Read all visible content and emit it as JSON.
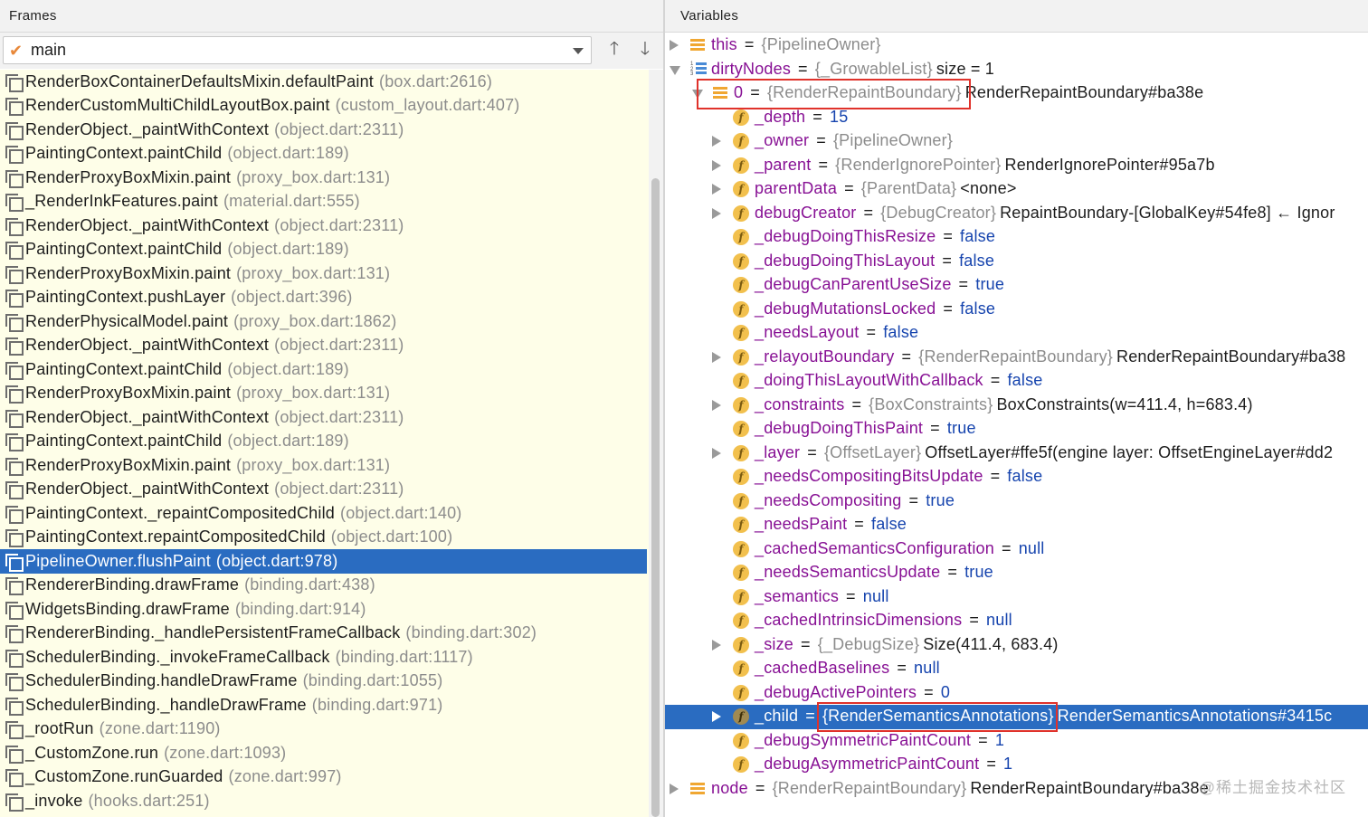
{
  "frames_panel": {
    "title": "Frames",
    "thread": {
      "check": "✔",
      "name": "main"
    },
    "up_arrow": "🡑",
    "down_arrow": "🡓",
    "frames": [
      {
        "name": "RenderBoxContainerDefaultsMixin.defaultPaint",
        "loc": "(box.dart:2616)"
      },
      {
        "name": "RenderCustomMultiChildLayoutBox.paint",
        "loc": "(custom_layout.dart:407)"
      },
      {
        "name": "RenderObject._paintWithContext",
        "loc": "(object.dart:2311)"
      },
      {
        "name": "PaintingContext.paintChild",
        "loc": "(object.dart:189)"
      },
      {
        "name": "RenderProxyBoxMixin.paint",
        "loc": "(proxy_box.dart:131)"
      },
      {
        "name": "_RenderInkFeatures.paint",
        "loc": "(material.dart:555)"
      },
      {
        "name": "RenderObject._paintWithContext",
        "loc": "(object.dart:2311)"
      },
      {
        "name": "PaintingContext.paintChild",
        "loc": "(object.dart:189)"
      },
      {
        "name": "RenderProxyBoxMixin.paint",
        "loc": "(proxy_box.dart:131)"
      },
      {
        "name": "PaintingContext.pushLayer",
        "loc": "(object.dart:396)"
      },
      {
        "name": "RenderPhysicalModel.paint",
        "loc": "(proxy_box.dart:1862)"
      },
      {
        "name": "RenderObject._paintWithContext",
        "loc": "(object.dart:2311)"
      },
      {
        "name": "PaintingContext.paintChild",
        "loc": "(object.dart:189)"
      },
      {
        "name": "RenderProxyBoxMixin.paint",
        "loc": "(proxy_box.dart:131)"
      },
      {
        "name": "RenderObject._paintWithContext",
        "loc": "(object.dart:2311)"
      },
      {
        "name": "PaintingContext.paintChild",
        "loc": "(object.dart:189)"
      },
      {
        "name": "RenderProxyBoxMixin.paint",
        "loc": "(proxy_box.dart:131)"
      },
      {
        "name": "RenderObject._paintWithContext",
        "loc": "(object.dart:2311)"
      },
      {
        "name": "PaintingContext._repaintCompositedChild",
        "loc": "(object.dart:140)"
      },
      {
        "name": "PaintingContext.repaintCompositedChild",
        "loc": "(object.dart:100)"
      },
      {
        "name": "PipelineOwner.flushPaint",
        "loc": "(object.dart:978)",
        "selected": true
      },
      {
        "name": "RendererBinding.drawFrame",
        "loc": "(binding.dart:438)"
      },
      {
        "name": "WidgetsBinding.drawFrame",
        "loc": "(binding.dart:914)"
      },
      {
        "name": "RendererBinding._handlePersistentFrameCallback",
        "loc": "(binding.dart:302)"
      },
      {
        "name": "SchedulerBinding._invokeFrameCallback",
        "loc": "(binding.dart:1117)"
      },
      {
        "name": "SchedulerBinding.handleDrawFrame",
        "loc": "(binding.dart:1055)"
      },
      {
        "name": "SchedulerBinding._handleDrawFrame",
        "loc": "(binding.dart:971)"
      },
      {
        "name": "_rootRun",
        "loc": "(zone.dart:1190)"
      },
      {
        "name": "_CustomZone.run",
        "loc": "(zone.dart:1093)"
      },
      {
        "name": "_CustomZone.runGuarded",
        "loc": "(zone.dart:997)"
      },
      {
        "name": "_invoke",
        "loc": "(hooks.dart:251)"
      }
    ]
  },
  "variables_panel": {
    "title": "Variables",
    "vars": [
      {
        "level": 0,
        "toggle": "closed",
        "icon": "object",
        "name": "this",
        "type": "{PipelineOwner}",
        "value": ""
      },
      {
        "level": 0,
        "toggle": "open",
        "icon": "list",
        "name": "dirtyNodes",
        "type": "{_GrowableList}",
        "value": "size = 1"
      },
      {
        "level": 1,
        "toggle": "open",
        "icon": "object",
        "name": "0",
        "type": "{RenderRepaintBoundary}",
        "value": "RenderRepaintBoundary#ba38e",
        "highlight": true
      },
      {
        "level": 2,
        "toggle": "none",
        "icon": "field",
        "name": "_depth",
        "type": "",
        "value": "15",
        "value_style": "literal"
      },
      {
        "level": 2,
        "toggle": "closed",
        "icon": "field",
        "name": "_owner",
        "type": "{PipelineOwner}",
        "value": ""
      },
      {
        "level": 2,
        "toggle": "closed",
        "icon": "field",
        "name": "_parent",
        "type": "{RenderIgnorePointer}",
        "value": "RenderIgnorePointer#95a7b"
      },
      {
        "level": 2,
        "toggle": "closed",
        "icon": "field",
        "name": "parentData",
        "type": "{ParentData}",
        "value": "<none>"
      },
      {
        "level": 2,
        "toggle": "closed",
        "icon": "field",
        "name": "debugCreator",
        "type": "{DebugCreator}",
        "value": "RepaintBoundary-[GlobalKey#54fe8] ← Ignor"
      },
      {
        "level": 2,
        "toggle": "none",
        "icon": "field",
        "name": "_debugDoingThisResize",
        "type": "",
        "value": "false",
        "value_style": "literal"
      },
      {
        "level": 2,
        "toggle": "none",
        "icon": "field",
        "name": "_debugDoingThisLayout",
        "type": "",
        "value": "false",
        "value_style": "literal"
      },
      {
        "level": 2,
        "toggle": "none",
        "icon": "field",
        "name": "_debugCanParentUseSize",
        "type": "",
        "value": "true",
        "value_style": "literal"
      },
      {
        "level": 2,
        "toggle": "none",
        "icon": "field",
        "name": "_debugMutationsLocked",
        "type": "",
        "value": "false",
        "value_style": "literal"
      },
      {
        "level": 2,
        "toggle": "none",
        "icon": "field",
        "name": "_needsLayout",
        "type": "",
        "value": "false",
        "value_style": "literal"
      },
      {
        "level": 2,
        "toggle": "closed",
        "icon": "field",
        "name": "_relayoutBoundary",
        "type": "{RenderRepaintBoundary}",
        "value": "RenderRepaintBoundary#ba38"
      },
      {
        "level": 2,
        "toggle": "none",
        "icon": "field",
        "name": "_doingThisLayoutWithCallback",
        "type": "",
        "value": "false",
        "value_style": "literal"
      },
      {
        "level": 2,
        "toggle": "closed",
        "icon": "field",
        "name": "_constraints",
        "type": "{BoxConstraints}",
        "value": "BoxConstraints(w=411.4, h=683.4)"
      },
      {
        "level": 2,
        "toggle": "none",
        "icon": "field",
        "name": "_debugDoingThisPaint",
        "type": "",
        "value": "true",
        "value_style": "literal"
      },
      {
        "level": 2,
        "toggle": "closed",
        "icon": "field",
        "name": "_layer",
        "type": "{OffsetLayer}",
        "value": "OffsetLayer#ffe5f(engine layer: OffsetEngineLayer#dd2"
      },
      {
        "level": 2,
        "toggle": "none",
        "icon": "field",
        "name": "_needsCompositingBitsUpdate",
        "type": "",
        "value": "false",
        "value_style": "literal"
      },
      {
        "level": 2,
        "toggle": "none",
        "icon": "field",
        "name": "_needsCompositing",
        "type": "",
        "value": "true",
        "value_style": "literal"
      },
      {
        "level": 2,
        "toggle": "none",
        "icon": "field",
        "name": "_needsPaint",
        "type": "",
        "value": "false",
        "value_style": "literal"
      },
      {
        "level": 2,
        "toggle": "none",
        "icon": "field",
        "name": "_cachedSemanticsConfiguration",
        "type": "",
        "value": "null",
        "value_style": "literal"
      },
      {
        "level": 2,
        "toggle": "none",
        "icon": "field",
        "name": "_needsSemanticsUpdate",
        "type": "",
        "value": "true",
        "value_style": "literal"
      },
      {
        "level": 2,
        "toggle": "none",
        "icon": "field",
        "name": "_semantics",
        "type": "",
        "value": "null",
        "value_style": "literal"
      },
      {
        "level": 2,
        "toggle": "none",
        "icon": "field",
        "name": "_cachedIntrinsicDimensions",
        "type": "",
        "value": "null",
        "value_style": "literal"
      },
      {
        "level": 2,
        "toggle": "closed",
        "icon": "field",
        "name": "_size",
        "type": "{_DebugSize}",
        "value": "Size(411.4, 683.4)"
      },
      {
        "level": 2,
        "toggle": "none",
        "icon": "field",
        "name": "_cachedBaselines",
        "type": "",
        "value": "null",
        "value_style": "literal"
      },
      {
        "level": 2,
        "toggle": "none",
        "icon": "field",
        "name": "_debugActivePointers",
        "type": "",
        "value": "0",
        "value_style": "literal"
      },
      {
        "level": 2,
        "toggle": "closed",
        "icon": "field",
        "name": "_child",
        "type": "{RenderSemanticsAnnotations}",
        "value": "RenderSemanticsAnnotations#3415c",
        "selected": true,
        "highlight_type": true
      },
      {
        "level": 2,
        "toggle": "none",
        "icon": "field",
        "name": "_debugSymmetricPaintCount",
        "type": "",
        "value": "1",
        "value_style": "literal"
      },
      {
        "level": 2,
        "toggle": "none",
        "icon": "field",
        "name": "_debugAsymmetricPaintCount",
        "type": "",
        "value": "1",
        "value_style": "literal"
      },
      {
        "level": 0,
        "toggle": "closed",
        "icon": "object",
        "name": "node",
        "type": "{RenderRepaintBoundary}",
        "value": "RenderRepaintBoundary#ba38e"
      }
    ]
  },
  "watermark": "@稀土掘金技术社区",
  "colors": {
    "selection": "#2a6cc1",
    "frames_bg": "#fefee8",
    "highlight_box": "#e0322b"
  }
}
